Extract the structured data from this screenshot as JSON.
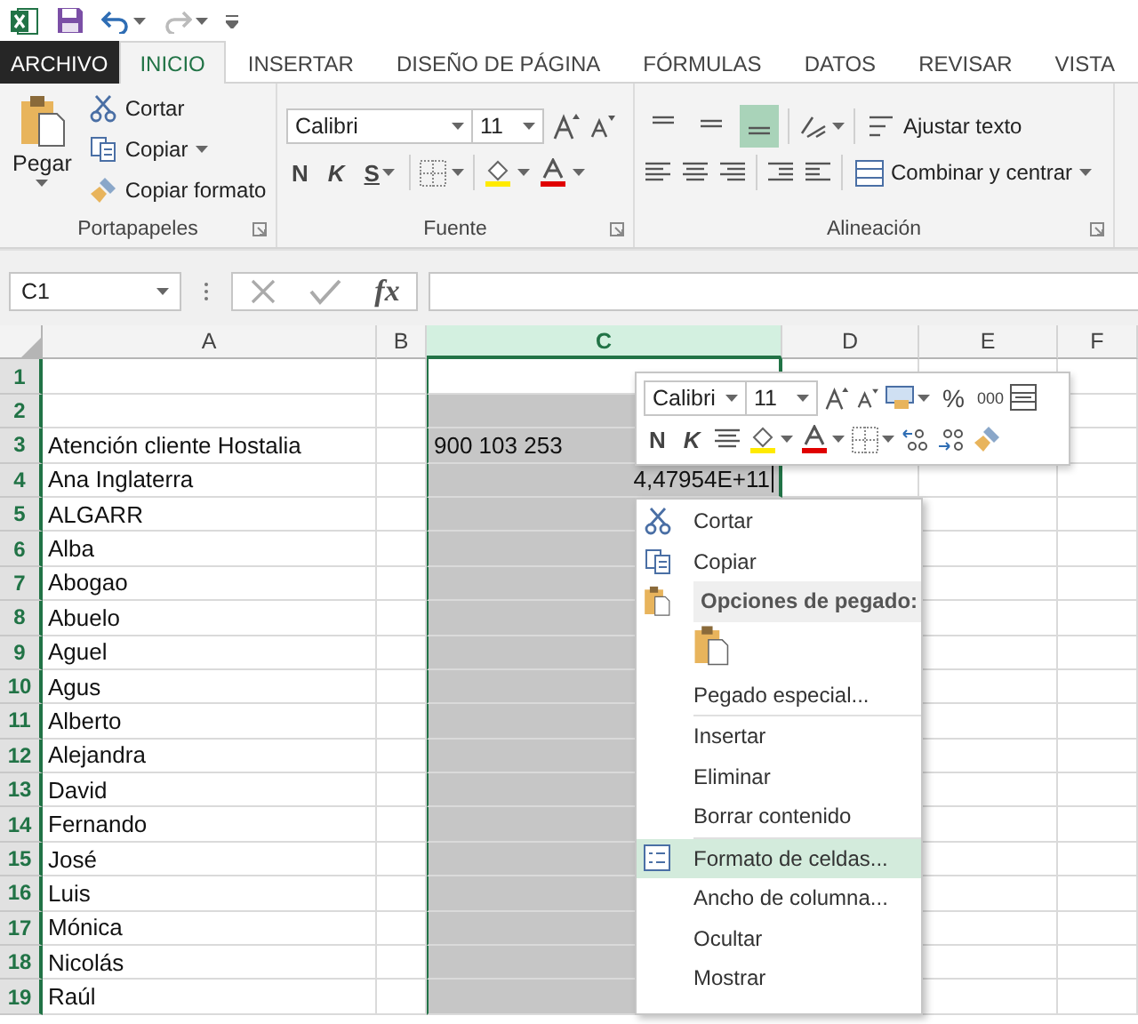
{
  "tabs": [
    {
      "label": "ARCHIVO",
      "kind": "file",
      "selected": false
    },
    {
      "label": "INICIO",
      "kind": "tab",
      "selected": true
    },
    {
      "label": "INSERTAR",
      "kind": "tab",
      "selected": false
    },
    {
      "label": "DISEÑO DE PÁGINA",
      "kind": "tab",
      "selected": false
    },
    {
      "label": "FÓRMULAS",
      "kind": "tab",
      "selected": false
    },
    {
      "label": "DATOS",
      "kind": "tab",
      "selected": false
    },
    {
      "label": "REVISAR",
      "kind": "tab",
      "selected": false
    },
    {
      "label": "VISTA",
      "kind": "tab",
      "selected": false
    }
  ],
  "clipboard": {
    "title": "Portapapeles",
    "paste": "Pegar",
    "cut": "Cortar",
    "copy": "Copiar",
    "format_painter": "Copiar formato"
  },
  "font": {
    "title": "Fuente",
    "font_name": "Calibri",
    "font_size": "11",
    "bold": "N",
    "italic": "K",
    "underline": "S"
  },
  "alignment": {
    "title": "Alineación",
    "wrap_text": "Ajustar texto",
    "merge_center": "Combinar y centrar",
    "vertical": [
      {
        "selected": false
      },
      {
        "selected": false
      },
      {
        "selected": true
      }
    ]
  },
  "formula_bar": {
    "name_box": "C1",
    "function_label": "fx"
  },
  "columns": [
    {
      "label": "A",
      "selected": false
    },
    {
      "label": "B",
      "selected": false
    },
    {
      "label": "C",
      "selected": true
    },
    {
      "label": "D",
      "selected": false
    },
    {
      "label": "E",
      "selected": false
    },
    {
      "label": "F",
      "selected": false
    }
  ],
  "rows": [
    {
      "number": "1",
      "active": true
    },
    {
      "number": "2",
      "active": false
    },
    {
      "number": "3",
      "active": false,
      "col_a": "Atención cliente Hostalia",
      "col_c": "900 103 253"
    },
    {
      "number": "4",
      "active": false,
      "col_a": "Ana Inglaterra",
      "col_c_number": "4,47954E+11"
    },
    {
      "number": "5",
      "active": false,
      "col_a": "ALGARR"
    },
    {
      "number": "6",
      "active": false,
      "col_a": "Alba"
    },
    {
      "number": "7",
      "active": false,
      "col_a": "Abogao"
    },
    {
      "number": "8",
      "active": false,
      "col_a": "Abuelo"
    },
    {
      "number": "9",
      "active": false,
      "col_a": "Aguel"
    },
    {
      "number": "10",
      "active": false,
      "col_a": "Agus"
    },
    {
      "number": "11",
      "active": false,
      "col_a": "Alberto"
    },
    {
      "number": "12",
      "active": false,
      "col_a": "Alejandra"
    },
    {
      "number": "13",
      "active": false,
      "col_a": "David"
    },
    {
      "number": "14",
      "active": false,
      "col_a": "Fernando"
    },
    {
      "number": "15",
      "active": false,
      "col_a": "José"
    },
    {
      "number": "16",
      "active": false,
      "col_a": "Luis"
    },
    {
      "number": "17",
      "active": false,
      "col_a": "Mónica"
    },
    {
      "number": "18",
      "active": false,
      "col_a": "Nicolás"
    },
    {
      "number": "19",
      "active": false,
      "col_a": "Raúl"
    }
  ],
  "mini_toolbar": {
    "font_name": "Calibri",
    "font_size": "11",
    "bold": "N",
    "italic": "K",
    "percent": "%",
    "thousands": "000"
  },
  "context_menu": [
    {
      "label": "Cortar",
      "kind": "cut",
      "selected": false
    },
    {
      "label": "Copiar",
      "kind": "copy",
      "selected": false
    },
    {
      "label": "Opciones de pegado:",
      "kind": "header",
      "selected": false
    },
    {
      "kind": "paste_options",
      "selected": false
    },
    {
      "label": "Pegado especial...",
      "kind": "plain",
      "selected": false,
      "separator_after": true
    },
    {
      "label": "Insertar",
      "kind": "plain",
      "selected": false
    },
    {
      "label": "Eliminar",
      "kind": "plain",
      "selected": false
    },
    {
      "label": "Borrar contenido",
      "kind": "plain",
      "selected": false,
      "separator_after": true
    },
    {
      "label": "Formato de celdas...",
      "kind": "format",
      "selected": true
    },
    {
      "label": "Ancho de columna...",
      "kind": "plain",
      "selected": false
    },
    {
      "label": "Ocultar",
      "kind": "plain",
      "selected": false
    },
    {
      "label": "Mostrar",
      "kind": "plain",
      "selected": false
    }
  ]
}
